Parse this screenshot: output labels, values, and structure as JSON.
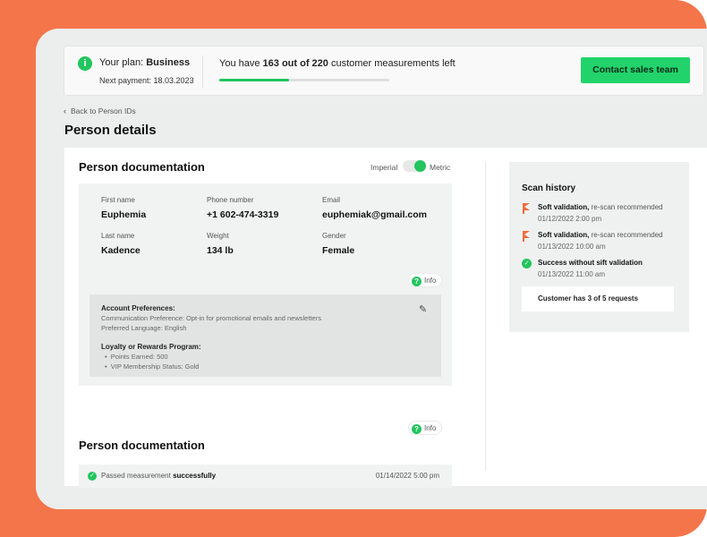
{
  "plan": {
    "label": "Your plan:",
    "name": "Business",
    "next_payment": "Next payment: 18.03.2023"
  },
  "usage": {
    "prefix": "You have",
    "used": "163 out of 220",
    "suffix": "customer measurements left",
    "progress_fraction": 0.41
  },
  "header": {
    "contact_button": "Contact sales team",
    "back_link": "Back to Person IDs",
    "page_title": "Person details"
  },
  "documentation": {
    "title": "Person documentation",
    "unit_imperial": "Imperial",
    "unit_metric": "Metric",
    "unit_selected": "Metric",
    "fields": {
      "first_name_label": "First name",
      "first_name": "Euphemia",
      "phone_label": "Phone number",
      "phone": "+1 602-474-3319",
      "email_label": "Email",
      "email": "euphemiak@gmail.com",
      "last_name_label": "Last name",
      "last_name": "Kadence",
      "weight_label": "Weight",
      "weight": "134 lb",
      "gender_label": "Gender",
      "gender": "Female"
    },
    "info_label": "Info",
    "preferences": {
      "title": "Account Preferences:",
      "communication": "Communication Preference: Opt-in for promotional emails and newsletters",
      "language": "Preferred Language: English",
      "loyalty_title": "Loyalty or Rewards Program:",
      "points": "Points Earned: 500",
      "vip": "VIP Membership Status: Gold"
    }
  },
  "documentation2": {
    "title": "Person documentation",
    "info_label": "Info",
    "status_prefix": "Passed measurement",
    "status_strong": "successfully",
    "status_time": "01/14/2022 5:00 pm"
  },
  "scan_history": {
    "title": "Scan history",
    "items": [
      {
        "strong": "Soft validation,",
        "rest": "re-scan recommended",
        "date": "01/12/2022 2:00 pm",
        "icon": "flag-icon"
      },
      {
        "strong": "Soft validation,",
        "rest": "re-scan recommended",
        "date": "01/13/2022 10:00 am",
        "icon": "flag-icon"
      },
      {
        "strong": "Success without sift validation",
        "rest": "",
        "date": "01/13/2022 11:00 am",
        "icon": "check-circle-icon"
      }
    ],
    "requests": "Customer has 3 of 5 requests"
  },
  "colors": {
    "accent_green": "#22c55e",
    "button_green": "#22d36b",
    "brand_orange": "#f4754a",
    "flag_orange": "#f06c3a"
  }
}
